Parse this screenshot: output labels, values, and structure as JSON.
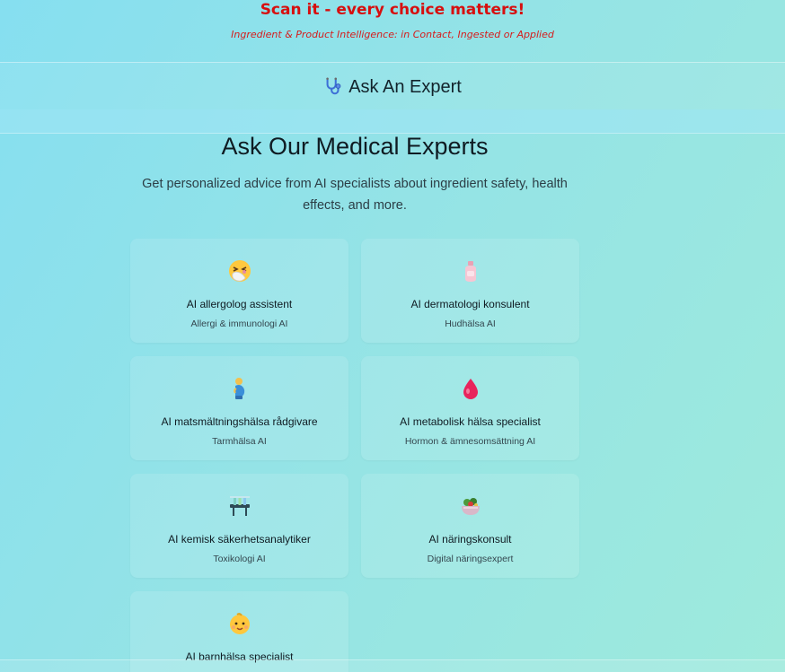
{
  "banner": {
    "tagline": "Scan it - every choice matters!",
    "subtagline": "Ingredient & Product Intelligence: in Contact, Ingested or Applied"
  },
  "header": {
    "icon": "stethoscope-icon",
    "title": "Ask An Expert"
  },
  "main": {
    "title": "Ask Our Medical Experts",
    "description": "Get personalized advice from AI specialists about ingredient safety, health effects, and more."
  },
  "experts": [
    {
      "icon": "sneezing-face-icon",
      "title": "AI allergolog assistent",
      "subtitle": "Allergi & immunologi AI"
    },
    {
      "icon": "lotion-bottle-icon",
      "title": "AI dermatologi konsulent",
      "subtitle": "Hudhälsa AI"
    },
    {
      "icon": "pregnant-person-icon",
      "title": "AI matsmältningshälsa rådgivare",
      "subtitle": "Tarmhälsa AI"
    },
    {
      "icon": "drop-of-blood-icon",
      "title": "AI metabolisk hälsa specialist",
      "subtitle": "Hormon & ämnesomsättning AI"
    },
    {
      "icon": "test-tube-rack-icon",
      "title": "AI kemisk säkerhetsanalytiker",
      "subtitle": "Toxikologi AI"
    },
    {
      "icon": "salad-bowl-icon",
      "title": "AI näringskonsult",
      "subtitle": "Digital näringsexpert"
    },
    {
      "icon": "baby-icon",
      "title": "AI barnhälsa specialist",
      "subtitle": ""
    }
  ],
  "colors": {
    "tagline": "#d70f0f",
    "background_start": "#86dff0",
    "background_end": "#9eeadc"
  }
}
